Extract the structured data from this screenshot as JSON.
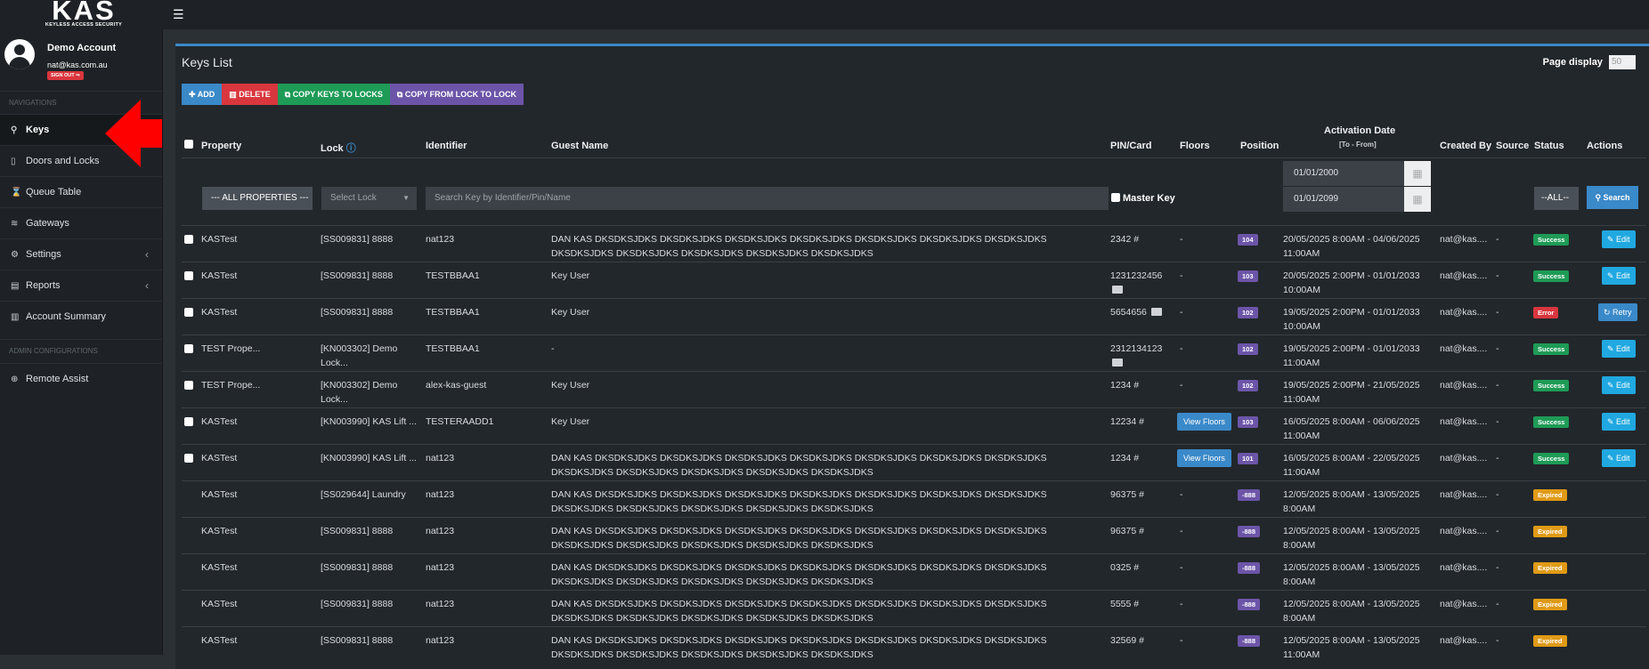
{
  "brand": {
    "logo_text": "KAS",
    "tagline": "KEYLESS ACCESS SECURITY"
  },
  "user": {
    "name": "Demo Account",
    "email": "nat@kas.com.au",
    "signout_label": "SIGN OUT ⇒"
  },
  "sidebar": {
    "nav_header": "NAVIGATIONS",
    "admin_header": "ADMIN CONFIGURATIONS",
    "items": [
      {
        "label": "Keys",
        "icon": "key-icon"
      },
      {
        "label": "Doors and Locks",
        "icon": "door-icon"
      },
      {
        "label": "Queue Table",
        "icon": "hourglass-icon"
      },
      {
        "label": "Gateways",
        "icon": "wifi-icon"
      },
      {
        "label": "Settings",
        "icon": "gears-icon"
      },
      {
        "label": "Reports",
        "icon": "report-icon"
      },
      {
        "label": "Account Summary",
        "icon": "bar-chart-icon"
      }
    ],
    "admin_items": [
      {
        "label": "Remote Assist",
        "icon": "lifebuoy-icon"
      }
    ]
  },
  "panel": {
    "title": "Keys List",
    "page_display_label": "Page display",
    "page_display_value": "50"
  },
  "toolbar": {
    "add_label": "ADD",
    "delete_label": "DELETE",
    "copy_keys_label": "COPY KEYS TO LOCKS",
    "copy_from_label": "COPY FROM LOCK TO LOCK"
  },
  "table": {
    "headers": {
      "property": "Property",
      "lock": "Lock",
      "identifier": "Identifier",
      "guest_name": "Guest Name",
      "pin_card": "PIN/Card",
      "floors": "Floors",
      "position": "Position",
      "activation_date": "Activation Date",
      "activation_sub": "[To - From]",
      "created_by": "Created By",
      "source": "Source",
      "status": "Status",
      "actions": "Actions"
    },
    "filters": {
      "property": "--- ALL PROPERTIES ---",
      "lock_placeholder": "Select Lock",
      "search_placeholder": "Search Key by Identifier/Pin/Name",
      "master_key_label": "Master Key",
      "date_from": "01/01/2000",
      "date_to": "01/01/2099",
      "status": "--ALL--",
      "search_label": "Search"
    },
    "rows": [
      {
        "checkbox": true,
        "property": "KASTest",
        "lock": "[SS009831] 8888",
        "identifier": "nat123",
        "guest_name": "DAN KAS DKSDKSJDKS DKSDKSJDKS DKSDKSJDKS DKSDKSJDKS DKSDKSJDKS DKSDKSJDKS DKSDKSJDKS DKSDKSJDKS DKSDKSJDKS DKSDKSJDKS DKSDKSJDKS DKSDKSJDKS",
        "pin": "2342 #",
        "card_icon": false,
        "floors": "-",
        "floors_button": false,
        "position": "104",
        "activation_1": "20/05/2025 8:00AM - 04/06/2025",
        "activation_2": "11:00AM",
        "created_by": "nat@kas....",
        "source": "-",
        "status": "Success",
        "status_type": "success",
        "action": "Edit"
      },
      {
        "checkbox": true,
        "property": "KASTest",
        "lock": "[SS009831] 8888",
        "identifier": "TESTBBAA1",
        "guest_name": "Key User",
        "pin": "1231232456",
        "card_icon": true,
        "floors": "-",
        "floors_button": false,
        "position": "103",
        "activation_1": "20/05/2025 2:00PM - 01/01/2033",
        "activation_2": "10:00AM",
        "created_by": "nat@kas....",
        "source": "-",
        "status": "Success",
        "status_type": "success",
        "action": "Edit"
      },
      {
        "checkbox": true,
        "property": "KASTest",
        "lock": "[SS009831] 8888",
        "identifier": "TESTBBAA1",
        "guest_name": "Key User",
        "pin": "5654656",
        "card_icon": true,
        "floors": "-",
        "floors_button": false,
        "position": "102",
        "activation_1": "19/05/2025 2:00PM - 01/01/2033",
        "activation_2": "10:00AM",
        "created_by": "nat@kas....",
        "source": "-",
        "status": "Error",
        "status_type": "error",
        "action": "Retry"
      },
      {
        "checkbox": true,
        "property": "TEST Prope...",
        "lock": "[KN003302] Demo",
        "lock_2": "Lock...",
        "identifier": "TESTBBAA1",
        "guest_name": "-",
        "pin": "2312134123",
        "card_icon": true,
        "floors": "-",
        "floors_button": false,
        "position": "102",
        "activation_1": "19/05/2025 2:00PM - 01/01/2033",
        "activation_2": "11:00AM",
        "created_by": "nat@kas....",
        "source": "-",
        "status": "Success",
        "status_type": "success",
        "action": "Edit"
      },
      {
        "checkbox": true,
        "property": "TEST Prope...",
        "lock": "[KN003302] Demo",
        "lock_2": "Lock...",
        "identifier": "alex-kas-guest",
        "guest_name": "Key User",
        "pin": "1234 #",
        "card_icon": false,
        "floors": "-",
        "floors_button": false,
        "position": "102",
        "activation_1": "19/05/2025 2:00PM - 21/05/2025",
        "activation_2": "11:00AM",
        "created_by": "nat@kas....",
        "source": "-",
        "status": "Success",
        "status_type": "success",
        "action": "Edit"
      },
      {
        "checkbox": true,
        "property": "KASTest",
        "lock": "[KN003990] KAS Lift ...",
        "identifier": "TESTERAADD1",
        "guest_name": "Key User",
        "pin": "12234 #",
        "card_icon": false,
        "floors": "View Floors",
        "floors_button": true,
        "position": "103",
        "activation_1": "16/05/2025 8:00AM - 06/06/2025",
        "activation_2": "11:00AM",
        "created_by": "nat@kas....",
        "source": "-",
        "status": "Success",
        "status_type": "success",
        "action": "Edit"
      },
      {
        "checkbox": true,
        "property": "KASTest",
        "lock": "[KN003990] KAS Lift ...",
        "identifier": "nat123",
        "guest_name": "DAN KAS DKSDKSJDKS DKSDKSJDKS DKSDKSJDKS DKSDKSJDKS DKSDKSJDKS DKSDKSJDKS DKSDKSJDKS DKSDKSJDKS DKSDKSJDKS DKSDKSJDKS DKSDKSJDKS DKSDKSJDKS",
        "pin": "1234 #",
        "card_icon": false,
        "floors": "View Floors",
        "floors_button": true,
        "position": "101",
        "activation_1": "16/05/2025 8:00AM - 22/05/2025",
        "activation_2": "11:00AM",
        "created_by": "nat@kas....",
        "source": "-",
        "status": "Success",
        "status_type": "success",
        "action": "Edit"
      },
      {
        "checkbox": false,
        "property": "KASTest",
        "lock": "[SS029644] Laundry",
        "identifier": "nat123",
        "guest_name": "DAN KAS DKSDKSJDKS DKSDKSJDKS DKSDKSJDKS DKSDKSJDKS DKSDKSJDKS DKSDKSJDKS DKSDKSJDKS DKSDKSJDKS DKSDKSJDKS DKSDKSJDKS DKSDKSJDKS DKSDKSJDKS",
        "pin": "96375 #",
        "card_icon": false,
        "floors": "-",
        "floors_button": false,
        "position": "-888",
        "activation_1": "12/05/2025 8:00AM - 13/05/2025",
        "activation_2": "8:00AM",
        "created_by": "nat@kas....",
        "source": "-",
        "status": "Expired",
        "status_type": "expired",
        "action": ""
      },
      {
        "checkbox": false,
        "property": "KASTest",
        "lock": "[SS009831] 8888",
        "identifier": "nat123",
        "guest_name": "DAN KAS DKSDKSJDKS DKSDKSJDKS DKSDKSJDKS DKSDKSJDKS DKSDKSJDKS DKSDKSJDKS DKSDKSJDKS DKSDKSJDKS DKSDKSJDKS DKSDKSJDKS DKSDKSJDKS DKSDKSJDKS",
        "pin": "96375 #",
        "card_icon": false,
        "floors": "-",
        "floors_button": false,
        "position": "-888",
        "activation_1": "12/05/2025 8:00AM - 13/05/2025",
        "activation_2": "8:00AM",
        "created_by": "nat@kas....",
        "source": "-",
        "status": "Expired",
        "status_type": "expired",
        "action": ""
      },
      {
        "checkbox": false,
        "property": "KASTest",
        "lock": "[SS009831] 8888",
        "identifier": "nat123",
        "guest_name": "DAN KAS DKSDKSJDKS DKSDKSJDKS DKSDKSJDKS DKSDKSJDKS DKSDKSJDKS DKSDKSJDKS DKSDKSJDKS DKSDKSJDKS DKSDKSJDKS DKSDKSJDKS DKSDKSJDKS DKSDKSJDKS",
        "pin": "0325 #",
        "card_icon": false,
        "floors": "-",
        "floors_button": false,
        "position": "-888",
        "activation_1": "12/05/2025 8:00AM - 13/05/2025",
        "activation_2": "8:00AM",
        "created_by": "nat@kas....",
        "source": "-",
        "status": "Expired",
        "status_type": "expired",
        "action": ""
      },
      {
        "checkbox": false,
        "property": "KASTest",
        "lock": "[SS009831] 8888",
        "identifier": "nat123",
        "guest_name": "DAN KAS DKSDKSJDKS DKSDKSJDKS DKSDKSJDKS DKSDKSJDKS DKSDKSJDKS DKSDKSJDKS DKSDKSJDKS DKSDKSJDKS DKSDKSJDKS DKSDKSJDKS DKSDKSJDKS DKSDKSJDKS",
        "pin": "5555 #",
        "card_icon": false,
        "floors": "-",
        "floors_button": false,
        "position": "-888",
        "activation_1": "12/05/2025 8:00AM - 13/05/2025",
        "activation_2": "8:00AM",
        "created_by": "nat@kas....",
        "source": "-",
        "status": "Expired",
        "status_type": "expired",
        "action": ""
      },
      {
        "checkbox": false,
        "property": "KASTest",
        "lock": "[SS009831] 8888",
        "identifier": "nat123",
        "guest_name": "DAN KAS DKSDKSJDKS DKSDKSJDKS DKSDKSJDKS DKSDKSJDKS DKSDKSJDKS DKSDKSJDKS DKSDKSJDKS DKSDKSJDKS DKSDKSJDKS DKSDKSJDKS DKSDKSJDKS DKSDKSJDKS",
        "pin": "32569 #",
        "card_icon": false,
        "floors": "-",
        "floors_button": false,
        "position": "-888",
        "activation_1": "12/05/2025 8:00AM - 13/05/2025",
        "activation_2": "11:00AM",
        "created_by": "nat@kas....",
        "source": "-",
        "status": "Expired",
        "status_type": "expired",
        "action": ""
      }
    ]
  },
  "colors": {
    "accent": "#3a89c9",
    "success": "#1e9b56",
    "error": "#d9363e",
    "expired": "#e09a16",
    "position_badge": "#6c55a8",
    "edit": "#20a8e0",
    "pointer_arrow": "#ff0000"
  }
}
